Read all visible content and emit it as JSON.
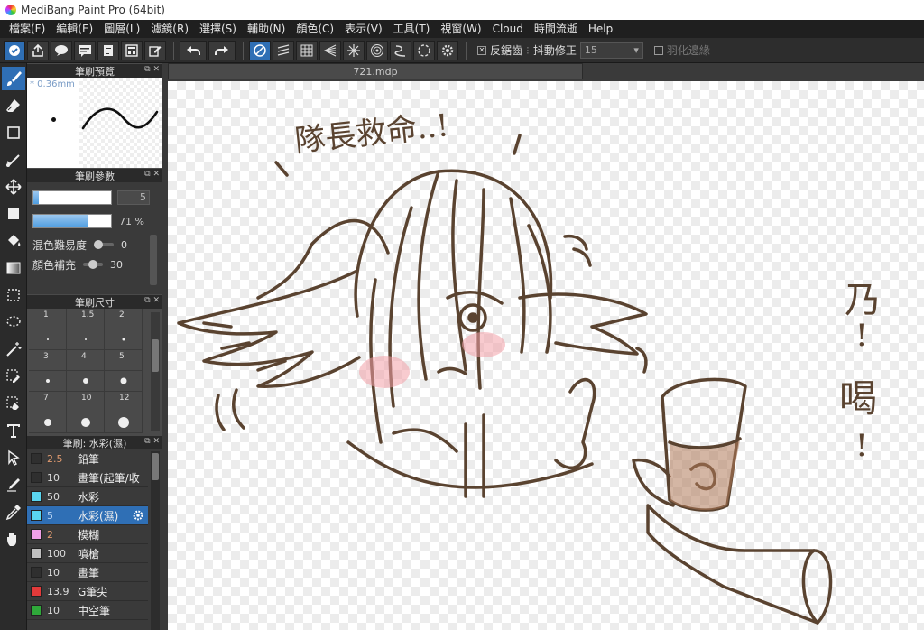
{
  "window": {
    "title": "MediBang Paint Pro (64bit)"
  },
  "menu": [
    "檔案(F)",
    "編輯(E)",
    "圖層(L)",
    "濾鏡(R)",
    "選擇(S)",
    "輔助(N)",
    "顏色(C)",
    "表示(V)",
    "工具(T)",
    "視窗(W)",
    "Cloud",
    "時間流逝",
    "Help"
  ],
  "toolbar": {
    "antialias_label": "反鋸齒",
    "stabilizer_label": "抖動修正",
    "stabilizer_value": "15",
    "feather_label": "羽化邊緣",
    "antialias_checked": true,
    "feather_checked": false
  },
  "panels": {
    "preview": {
      "title": "筆刷預覽",
      "size": "* 0.36mm"
    },
    "params": {
      "title": "筆刷參數",
      "size_value": "5",
      "opacity_value": "71 %",
      "opacity_percent": 71,
      "blend_label": "混色難易度",
      "blend_value": "0",
      "fill_label": "顏色補充",
      "fill_value": "30"
    },
    "sizes": {
      "title": "筆刷尺寸",
      "labels": [
        "1",
        "1.5",
        "2",
        "3",
        "4",
        "5",
        "7",
        "10",
        "12"
      ]
    },
    "brushes": {
      "title": "筆刷: 水彩(濕)",
      "items": [
        {
          "size": "2.5",
          "name": "鉛筆",
          "color": "#2f2f2f",
          "accent": true
        },
        {
          "size": "10",
          "name": "畫筆(起筆/收",
          "color": "#2f2f2f",
          "accent": false
        },
        {
          "size": "50",
          "name": "水彩",
          "color": "#5ad6f0",
          "accent": false
        },
        {
          "size": "5",
          "name": "水彩(濕)",
          "color": "#5ad6f0",
          "accent": false,
          "selected": true
        },
        {
          "size": "2",
          "name": "模糊",
          "color": "#f0a0e8",
          "accent": true
        },
        {
          "size": "100",
          "name": "噴槍",
          "color": "#bfbfbf",
          "accent": false
        },
        {
          "size": "10",
          "name": "畫筆",
          "color": "#2f2f2f",
          "accent": false
        },
        {
          "size": "13.9",
          "name": "G筆尖",
          "color": "#e23a3a",
          "accent": false
        },
        {
          "size": "10",
          "name": "中空筆",
          "color": "#2fa83a",
          "accent": false
        }
      ]
    }
  },
  "document": {
    "tab_label": "721.mdp"
  },
  "canvas_text": {
    "shout": "隊長救命..!",
    "side_1": "乃",
    "side_2": "!",
    "side_3": "喝",
    "side_4": "!"
  },
  "colors": {
    "accent": "#2f6fb5",
    "line": "#5a4330"
  }
}
